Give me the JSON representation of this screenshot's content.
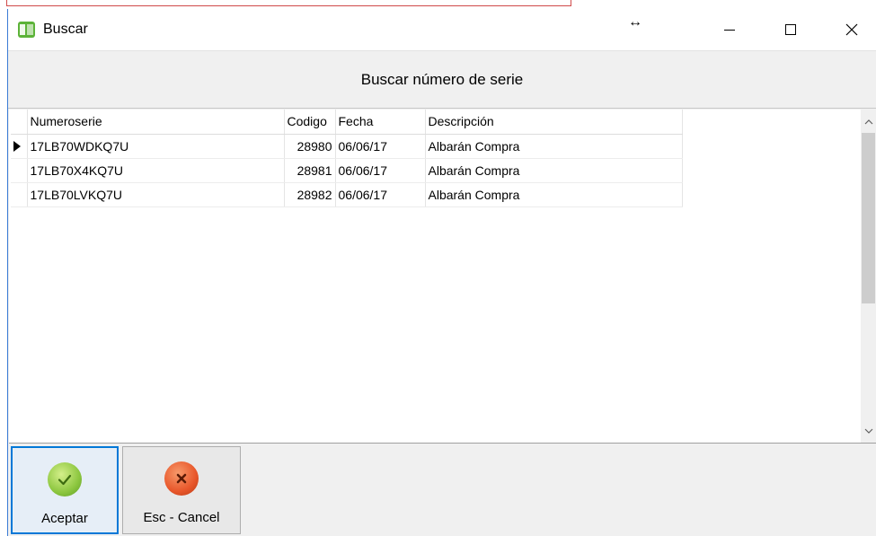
{
  "window": {
    "title": "Buscar",
    "resize_glyph": "↔"
  },
  "header": {
    "title": "Buscar número de serie"
  },
  "grid": {
    "columns": [
      "Numeroserie",
      "Codigo",
      "Fecha",
      "Descripción"
    ],
    "rows": [
      {
        "numeroserie": "17LB70WDKQ7U",
        "codigo": "28980",
        "fecha": "06/06/17",
        "descripcion": "Albarán Compra"
      },
      {
        "numeroserie": "17LB70X4KQ7U",
        "codigo": "28981",
        "fecha": "06/06/17",
        "descripcion": "Albarán Compra"
      },
      {
        "numeroserie": "17LB70LVKQ7U",
        "codigo": "28982",
        "fecha": "06/06/17",
        "descripcion": "Albarán Compra"
      }
    ]
  },
  "footer": {
    "accept_label": "Aceptar",
    "cancel_label": "Esc - Cancel"
  },
  "icons": {
    "app": "app-green-icon",
    "accept": "check-circle-icon",
    "cancel": "x-circle-icon",
    "row_indicator": "triangle-right-icon"
  },
  "colors": {
    "accent": "#0078d7",
    "accept_green": "#8cc63f",
    "cancel_red": "#e8562a"
  }
}
